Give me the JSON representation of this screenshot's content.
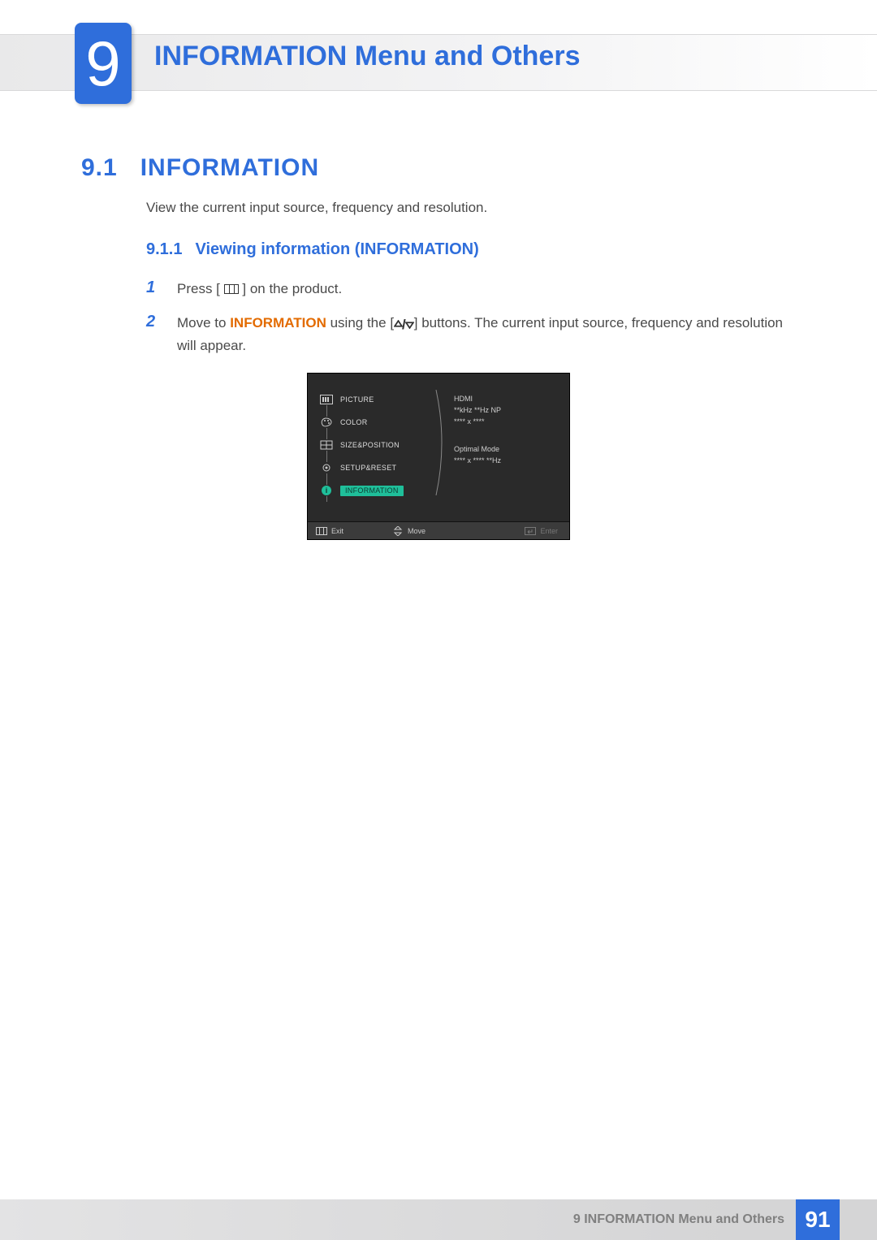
{
  "chapter": {
    "number": "9",
    "title": "INFORMATION Menu and Others"
  },
  "section": {
    "number": "9.1",
    "title": "INFORMATION",
    "intro": "View the current input source, frequency and resolution."
  },
  "subsection": {
    "number": "9.1.1",
    "title": "Viewing information (INFORMATION)"
  },
  "steps": {
    "1": {
      "num": "1",
      "pre": "Press [",
      "post": "] on the product."
    },
    "2": {
      "num": "2",
      "pre": "Move to ",
      "keyword": "INFORMATION",
      "mid": " using the [",
      "post": "] buttons. The current input source, frequency and resolution will appear."
    }
  },
  "osd": {
    "menu": {
      "picture": "PICTURE",
      "color": "COLOR",
      "sizepos": "SIZE&POSITION",
      "setup": "SETUP&RESET",
      "info": "INFORMATION"
    },
    "info": {
      "source": "HDMI",
      "freq": "**kHz **Hz NP",
      "res": "**** x ****",
      "optimal_label": "Optimal Mode",
      "optimal_value": "**** x ****   **Hz"
    },
    "footer": {
      "exit": "Exit",
      "move": "Move",
      "enter": "Enter"
    }
  },
  "footer": {
    "label": "9 INFORMATION Menu and Others",
    "page": "91"
  }
}
